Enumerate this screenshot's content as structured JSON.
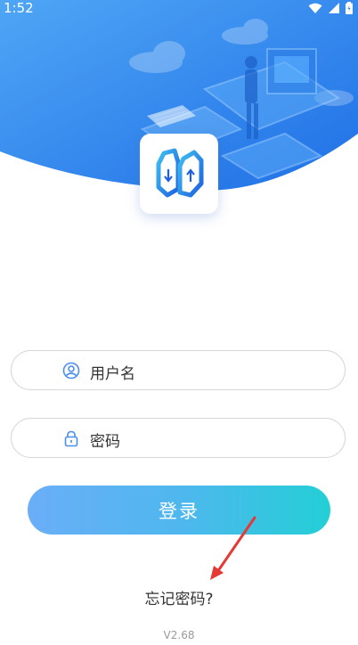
{
  "status_bar": {
    "time": "1:52"
  },
  "login": {
    "username_placeholder": "用户名",
    "password_placeholder": "密码",
    "login_button": "登录",
    "forgot_password": "忘记密码?",
    "version": "V2.68"
  },
  "colors": {
    "header_blue": "#2b8bf2",
    "button_start": "#6aaef8",
    "button_end": "#23cfd6",
    "annotation_red": "#e53935"
  }
}
